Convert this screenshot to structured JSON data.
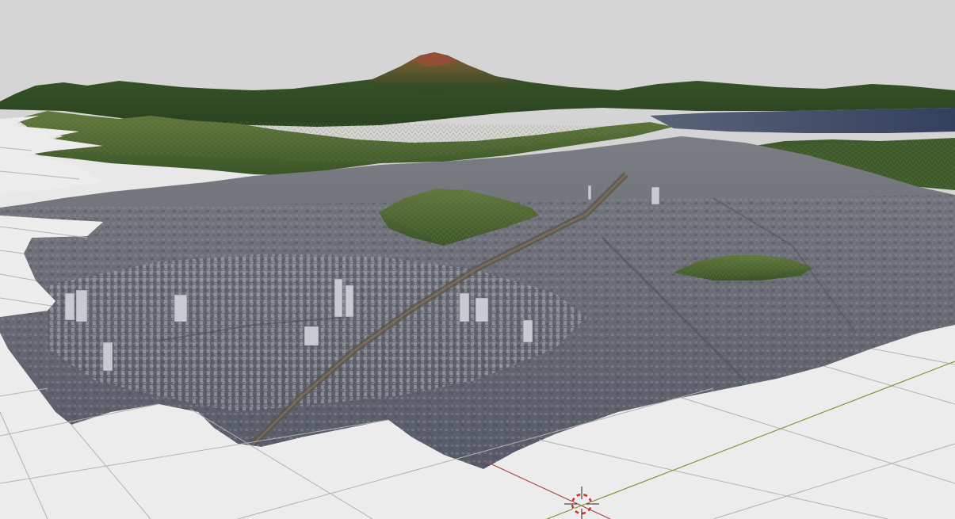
{
  "viewport": {
    "background_color": "#d4d4d4",
    "grid_tile_color": "#ececec",
    "grid_line_color": "#a8a8a8",
    "x_axis_color": "#b04848",
    "y_axis_color": "#7a9a3a",
    "city_base_color": "#6d6f78",
    "mountain_colors": [
      "#2e4a22",
      "#4f6b33",
      "#6e7a45"
    ],
    "water_color": "#3e4a66",
    "summit_color": "#8a4a36"
  },
  "scene_objects": {
    "terrain_model": "photogrammetry-terrain",
    "main_peak": "volcano-peak",
    "bay": "bay-water",
    "cursor_icon": "3d-cursor-icon"
  }
}
